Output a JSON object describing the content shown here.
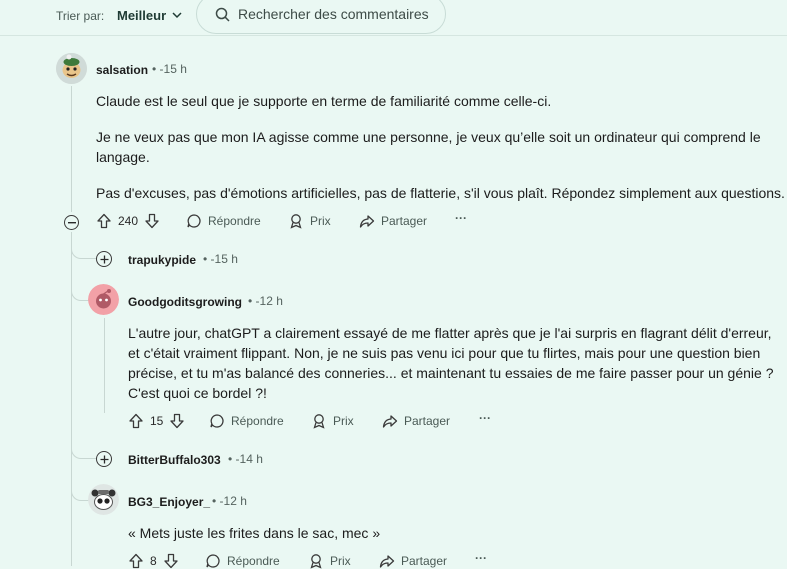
{
  "toolbar": {
    "sort_label": "Trier par:",
    "sort_value": "Meilleur",
    "search_placeholder": "Rechercher des commentaires"
  },
  "actions": {
    "reply": "Répondre",
    "award": "Prix",
    "share": "Partager",
    "more": "···"
  },
  "comments": [
    {
      "username": "salsation",
      "time": "• -15 h",
      "paragraphs": [
        "Claude est le seul que je supporte en terme de familiarité comme celle-ci.",
        "Je ne veux pas que mon IA agisse comme une personne, je veux qu’elle soit un ordinateur qui comprend le",
        "langage.",
        "Pas d'excuses, pas d'émotions artificielles, pas de flatterie, s'il vous plaît. Répondez simplement aux questions."
      ],
      "votes": "240"
    },
    {
      "username": "trapukypide",
      "time": "• -15 h",
      "collapsed": true
    },
    {
      "username": "Goodgoditsgrowing",
      "time": "• -12 h",
      "lines": [
        "L'autre jour, chatGPT a clairement essayé de me flatter après que je l'ai surpris en flagrant délit d'erreur,",
        "et c'était vraiment flippant. Non, je ne suis pas venu ici pour que tu flirtes, mais pour une question bien",
        "précise, et tu m'as balancé des conneries... et maintenant tu essaies de me faire passer pour un génie ?",
        "C'est quoi ce bordel ?!"
      ],
      "votes": "15"
    },
    {
      "username": "BitterBuffalo303",
      "time": "• -14 h",
      "collapsed": true
    },
    {
      "username": "BG3_Enjoyer_",
      "time": "• -12 h",
      "lines": [
        "« Mets juste les frites dans le sac, mec »"
      ],
      "votes": "8"
    }
  ],
  "colors": {
    "background": "#eaf8f3",
    "thread_line": "#c8d7d2"
  }
}
